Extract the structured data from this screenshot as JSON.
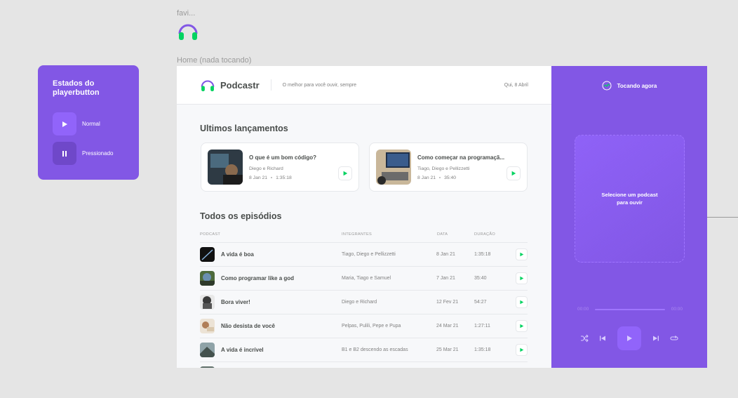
{
  "canvas": {
    "favicon_label": "favi...",
    "home_label": "Home (nada tocando)"
  },
  "states_panel": {
    "title": "Estados do playerbutton",
    "normal_label": "Normal",
    "pressed_label": "Pressionado"
  },
  "header": {
    "logo": "Podcastr",
    "tagline": "O melhor para você ouvir, sempre",
    "date": "Qui, 8 Abril"
  },
  "latest": {
    "title": "Ultimos lançamentos",
    "cards": [
      {
        "title": "O que é um bom código?",
        "members": "Diego e Richard",
        "date": "8 Jan 21",
        "duration": "1:35:18"
      },
      {
        "title": "Como começar na programaçã...",
        "members": "Tiago, Diego e Pellizzetti",
        "date": "8 Jan 21",
        "duration": "35:40"
      }
    ]
  },
  "all": {
    "title": "Todos os episódios",
    "columns": {
      "podcast": "PODCAST",
      "members": "INTEGRANTES",
      "date": "DATA",
      "duration": "DURAÇÃO"
    },
    "rows": [
      {
        "title": "A vida é boa",
        "members": "Tiago, Diego e Pellizzetti",
        "date": "8 Jan 21",
        "duration": "1:35:18"
      },
      {
        "title": "Como programar like a god",
        "members": "Maria, Tiago e Samuel",
        "date": "7 Jan 21",
        "duration": "35:40"
      },
      {
        "title": "Bora viver!",
        "members": "Diego e Richard",
        "date": "12 Fev 21",
        "duration": "54:27"
      },
      {
        "title": "Não desista de você",
        "members": "Pelpas, Pulili, Pepe e Pupa",
        "date": "24 Mar 21",
        "duration": "1:27:11"
      },
      {
        "title": "A vida é incrível",
        "members": "B1 e B2 descendo as escadas",
        "date": "25 Mar 21",
        "duration": "1:35:18"
      }
    ]
  },
  "player": {
    "header": "Tocando agora",
    "empty_text": "Selecione um podcast para ouvir",
    "time_start": "00:00",
    "time_end": "00:00"
  },
  "colors": {
    "brand": "#8257e5",
    "play_green": "#04d361",
    "text": "#494d4b",
    "muted": "#808080"
  },
  "icons": [
    "headphones-icon",
    "play-icon",
    "pause-icon",
    "shuffle-icon",
    "previous-icon",
    "next-icon",
    "repeat-icon"
  ]
}
